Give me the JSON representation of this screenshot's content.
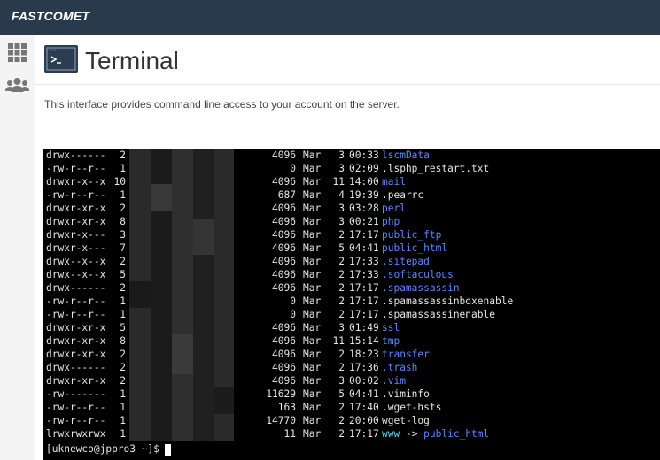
{
  "brand": "FASTCOMET",
  "sidebar": {
    "icons": [
      "grid-icon",
      "users-icon"
    ]
  },
  "page": {
    "title": "Terminal",
    "description": "This interface provides command line access to your account on the server."
  },
  "terminal": {
    "listing": [
      {
        "perms": "drwx------",
        "links": "2",
        "size": "4096",
        "month": "Mar",
        "day": "3",
        "time": "00:33",
        "name": "lscmData",
        "type": "dir"
      },
      {
        "perms": "-rw-r--r--",
        "links": "1",
        "size": "0",
        "month": "Mar",
        "day": "3",
        "time": "02:09",
        "name": ".lsphp_restart.txt",
        "type": "file"
      },
      {
        "perms": "drwxr-x--x",
        "links": "10",
        "size": "4096",
        "month": "Mar",
        "day": "11",
        "time": "14:00",
        "name": "mail",
        "type": "dir"
      },
      {
        "perms": "-rw-r--r--",
        "links": "1",
        "size": "687",
        "month": "Mar",
        "day": "4",
        "time": "19:39",
        "name": ".pearrc",
        "type": "file"
      },
      {
        "perms": "drwxr-xr-x",
        "links": "2",
        "size": "4096",
        "month": "Mar",
        "day": "3",
        "time": "03:28",
        "name": "perl",
        "type": "dir"
      },
      {
        "perms": "drwxr-xr-x",
        "links": "8",
        "size": "4096",
        "month": "Mar",
        "day": "3",
        "time": "00:21",
        "name": "php",
        "type": "dir"
      },
      {
        "perms": "drwxr-x---",
        "links": "3",
        "size": "4096",
        "month": "Mar",
        "day": "2",
        "time": "17:17",
        "name": "public_ftp",
        "type": "dir"
      },
      {
        "perms": "drwxr-x---",
        "links": "7",
        "size": "4096",
        "month": "Mar",
        "day": "5",
        "time": "04:41",
        "name": "public_html",
        "type": "dir"
      },
      {
        "perms": "drwx--x--x",
        "links": "2",
        "size": "4096",
        "month": "Mar",
        "day": "2",
        "time": "17:33",
        "name": ".sitepad",
        "type": "dir"
      },
      {
        "perms": "drwx--x--x",
        "links": "5",
        "size": "4096",
        "month": "Mar",
        "day": "2",
        "time": "17:33",
        "name": ".softaculous",
        "type": "dir"
      },
      {
        "perms": "drwx------",
        "links": "2",
        "size": "4096",
        "month": "Mar",
        "day": "2",
        "time": "17:17",
        "name": ".spamassassin",
        "type": "dir"
      },
      {
        "perms": "-rw-r--r--",
        "links": "1",
        "size": "0",
        "month": "Mar",
        "day": "2",
        "time": "17:17",
        "name": ".spamassassinboxenable",
        "type": "file"
      },
      {
        "perms": "-rw-r--r--",
        "links": "1",
        "size": "0",
        "month": "Mar",
        "day": "2",
        "time": "17:17",
        "name": ".spamassassinenable",
        "type": "file"
      },
      {
        "perms": "drwxr-xr-x",
        "links": "5",
        "size": "4096",
        "month": "Mar",
        "day": "3",
        "time": "01:49",
        "name": "ssl",
        "type": "dir"
      },
      {
        "perms": "drwxr-xr-x",
        "links": "8",
        "size": "4096",
        "month": "Mar",
        "day": "11",
        "time": "15:14",
        "name": "tmp",
        "type": "dir"
      },
      {
        "perms": "drwxr-xr-x",
        "links": "2",
        "size": "4096",
        "month": "Mar",
        "day": "2",
        "time": "18:23",
        "name": "transfer",
        "type": "dir"
      },
      {
        "perms": "drwx------",
        "links": "2",
        "size": "4096",
        "month": "Mar",
        "day": "2",
        "time": "17:36",
        "name": ".trash",
        "type": "dir"
      },
      {
        "perms": "drwxr-xr-x",
        "links": "2",
        "size": "4096",
        "month": "Mar",
        "day": "3",
        "time": "00:02",
        "name": ".vim",
        "type": "dir"
      },
      {
        "perms": "-rw-------",
        "links": "1",
        "size": "11629",
        "month": "Mar",
        "day": "5",
        "time": "04:41",
        "name": ".viminfo",
        "type": "file"
      },
      {
        "perms": "-rw-r--r--",
        "links": "1",
        "size": "163",
        "month": "Mar",
        "day": "2",
        "time": "17:40",
        "name": ".wget-hsts",
        "type": "file"
      },
      {
        "perms": "-rw-r--r--",
        "links": "1",
        "size": "14770",
        "month": "Mar",
        "day": "2",
        "time": "20:00",
        "name": "wget-log",
        "type": "file"
      },
      {
        "perms": "lrwxrwxrwx",
        "links": "1",
        "size": "11",
        "month": "Mar",
        "day": "2",
        "time": "17:17",
        "name": "www",
        "type": "link",
        "arrow": "->",
        "target": "public_html"
      }
    ],
    "prompt": "[uknewco@jppro3 ~]$"
  },
  "colors": {
    "topbar": "#2a3a4d",
    "dir": "#5e86ff",
    "symlink": "#5fd7ff",
    "terminal_bg": "#000000"
  }
}
